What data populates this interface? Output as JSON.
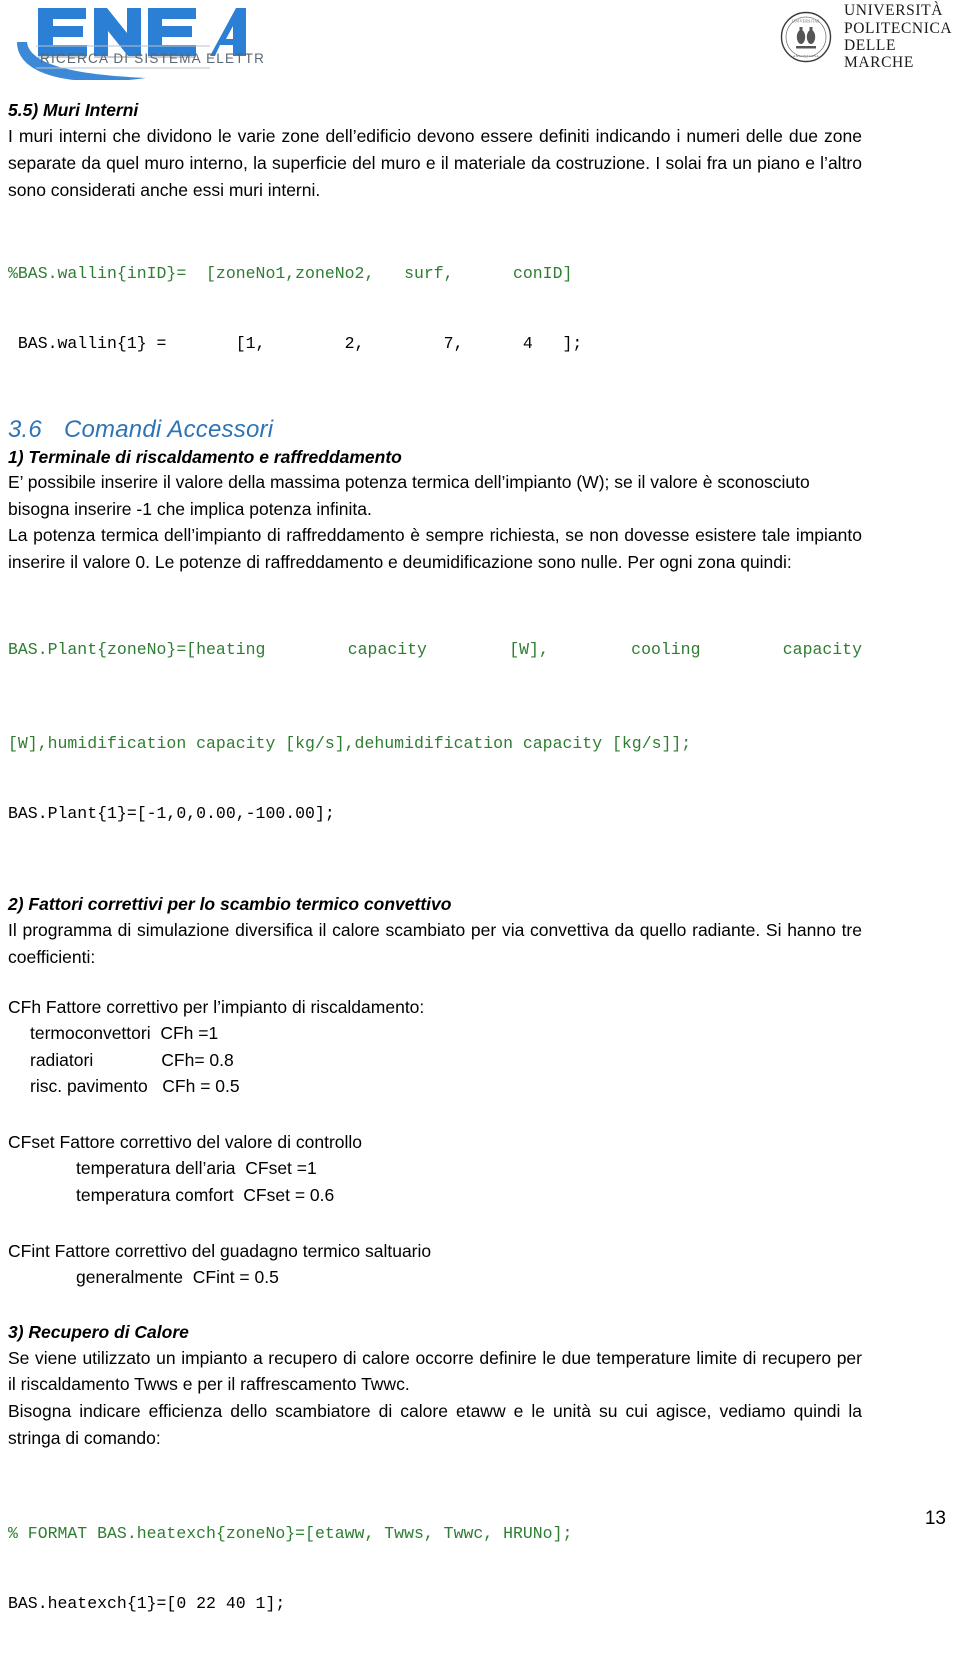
{
  "header": {
    "enea_logo_alt": "ENEA",
    "enea_tagline": "RICERCA DI SISTEMA ELETTRICO",
    "univ_line1": "UNIVERSITÀ",
    "univ_line2": "POLITECNICA",
    "univ_line3": "DELLE MARCHE"
  },
  "section_55": {
    "heading": "5.5) Muri Interni",
    "paragraph": "I muri interni che dividono le varie zone dell’edificio devono essere definiti indicando i numeri delle due zone separate da quel muro interno, la superficie del muro e il materiale da costruzione. I solai fra un piano e l’altro sono considerati anche essi muri interni.",
    "code": [
      {
        "text": "%BAS.wallin{inID}=  [zoneNo1,zoneNo2,   surf,      conID]",
        "color": "green"
      },
      {
        "text": " BAS.wallin{1} =       [1,        2,        7,      4   ];",
        "color": "black"
      }
    ]
  },
  "section_36": {
    "number": "3.6",
    "title": "Comandi Accessori",
    "item1": {
      "heading": "1) Terminale di riscaldamento e raffreddamento",
      "paragraph1": "E’ possibile inserire il valore della massima potenza termica dell’impianto (W); se il valore è sconosciuto bisogna inserire -1 che implica potenza infinita.",
      "paragraph2": "La potenza termica dell’impianto di raffreddamento è sempre richiesta, se non dovesse esistere tale impianto inserire il valore 0. Le potenze di raffreddamento e deumidificazione sono nulle. Per ogni zona quindi:",
      "code": [
        {
          "text": "BAS.Plant{zoneNo}=[heating capacity [W], cooling capacity",
          "color": "green",
          "justify": true
        },
        {
          "text": "[W],humidification capacity [kg/s],dehumidification capacity [kg/s]];",
          "color": "green",
          "justify": false
        },
        {
          "text": "BAS.Plant{1}=[-1,0,0.00,-100.00];",
          "color": "black",
          "justify": false
        }
      ]
    },
    "item2": {
      "heading": "2) Fattori correttivi per lo scambio termico convettivo",
      "paragraph": "Il programma di simulazione diversifica il calore scambiato per via convettiva da quello radiante. Si hanno tre coefficienti:",
      "cfh": {
        "title": "CFh Fattore correttivo per l’impianto di riscaldamento:",
        "rows": [
          "termoconvettori  CFh =1",
          "radiatori              CFh= 0.8",
          "risc. pavimento   CFh = 0.5"
        ]
      },
      "cfset": {
        "title": "CFset Fattore correttivo del valore di controllo",
        "rows": [
          "temperatura dell’aria  CFset =1",
          "temperatura comfort  CFset = 0.6"
        ]
      },
      "cfint": {
        "title": "CFint Fattore correttivo del guadagno termico saltuario",
        "rows": [
          "generalmente  CFint = 0.5"
        ]
      }
    },
    "item3": {
      "heading": "3) Recupero di Calore",
      "paragraph1": "Se viene utilizzato un impianto a recupero di calore occorre definire le due temperature limite di recupero per il riscaldamento Twws e per il raffrescamento Twwc.",
      "paragraph2": "Bisogna indicare efficienza dello scambiatore di calore etaww e le unità su cui agisce, vediamo quindi la stringa di comando:",
      "code": [
        {
          "text": "% FORMAT BAS.heatexch{zoneNo}=[etaww, Twws, Twwc, HRUNo];",
          "color": "green"
        },
        {
          "text": "BAS.heatexch{1}=[0 22 40 1];",
          "color": "black"
        }
      ]
    }
  },
  "footer": {
    "page_number": "13"
  },
  "colors": {
    "enea_blue": "#2B7FD4",
    "section_blue": "#2E74B5",
    "code_green": "#2E7D32",
    "text_black": "#000000"
  }
}
